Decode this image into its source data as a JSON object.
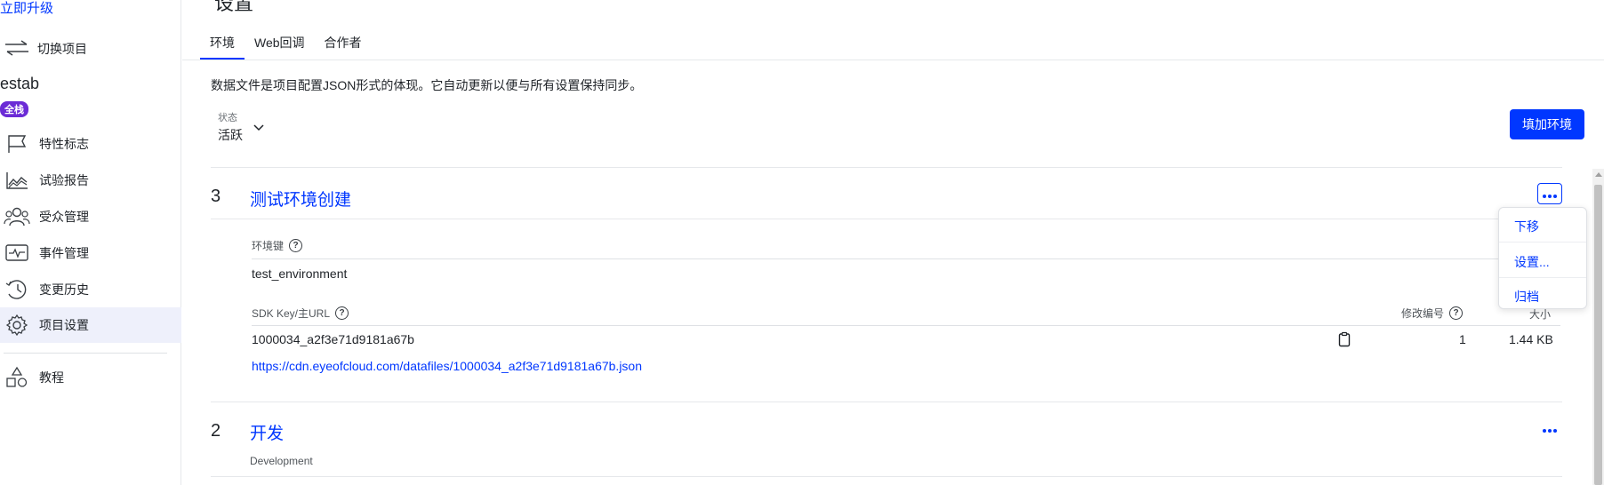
{
  "sidebar": {
    "upgrade_link": "立即升级",
    "switch_project": "切换项目",
    "project_name": "estab",
    "project_badge": "全栈",
    "items": [
      {
        "label": "特性标志",
        "icon": "flag-icon"
      },
      {
        "label": "试验报告",
        "icon": "chart-line-icon"
      },
      {
        "label": "受众管理",
        "icon": "users-icon"
      },
      {
        "label": "事件管理",
        "icon": "pulse-icon"
      },
      {
        "label": "变更历史",
        "icon": "history-icon"
      },
      {
        "label": "项目设置",
        "icon": "gear-icon",
        "active": true
      },
      {
        "label": "教程",
        "icon": "shapes-icon"
      }
    ]
  },
  "header": {
    "title_fragment": "设置"
  },
  "tabs": [
    {
      "label": "环境",
      "active": true
    },
    {
      "label": "Web回调"
    },
    {
      "label": "合作者"
    }
  ],
  "description": "数据文件是项目配置JSON形式的体现。它自动更新以便与所有设置保持同步。",
  "status_filter": {
    "label": "状态",
    "value": "活跃"
  },
  "add_env_button": "填加环境",
  "environments": [
    {
      "number": "3",
      "name": "测试环境创建",
      "env_key_label": "环境键",
      "env_key": "test_environment",
      "sdk_label": "SDK Key/主URL",
      "revision_label": "修改编号",
      "size_label": "大小",
      "sdk_key": "1000034_a2f3e71d9181a67b",
      "revision": "1",
      "size": "1.44 KB",
      "datafile_url": "https://cdn.eyeofcloud.com/datafiles/1000034_a2f3e71d9181a67b.json"
    },
    {
      "number": "2",
      "name": "开发",
      "subtitle": "Development"
    }
  ],
  "dropdown": {
    "items": [
      "下移",
      "设置...",
      "归档"
    ]
  },
  "colors": {
    "accent": "#0037ff",
    "badge": "#6b2bd6",
    "active_nav_bg": "#eef0fb"
  }
}
